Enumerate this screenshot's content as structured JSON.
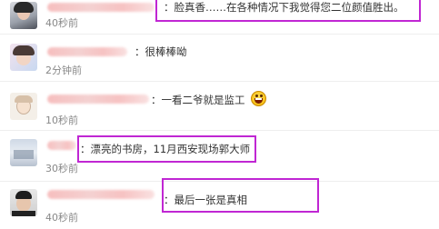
{
  "comments": [
    {
      "text": "：脸真香……在各种情况下我觉得您二位颜值胜出。",
      "time": "40秒前"
    },
    {
      "text": "：很棒棒呦",
      "time": "2分钟前"
    },
    {
      "text": "：一看二爷就是监工",
      "time": "10秒前",
      "emoji": "grinning-emoji"
    },
    {
      "text": "：漂亮的书房，11月西安现场郭大师",
      "time": "30秒前"
    },
    {
      "text": "：最后一张是真相",
      "time": "40秒前"
    }
  ],
  "highlight_color": "#c026d3"
}
